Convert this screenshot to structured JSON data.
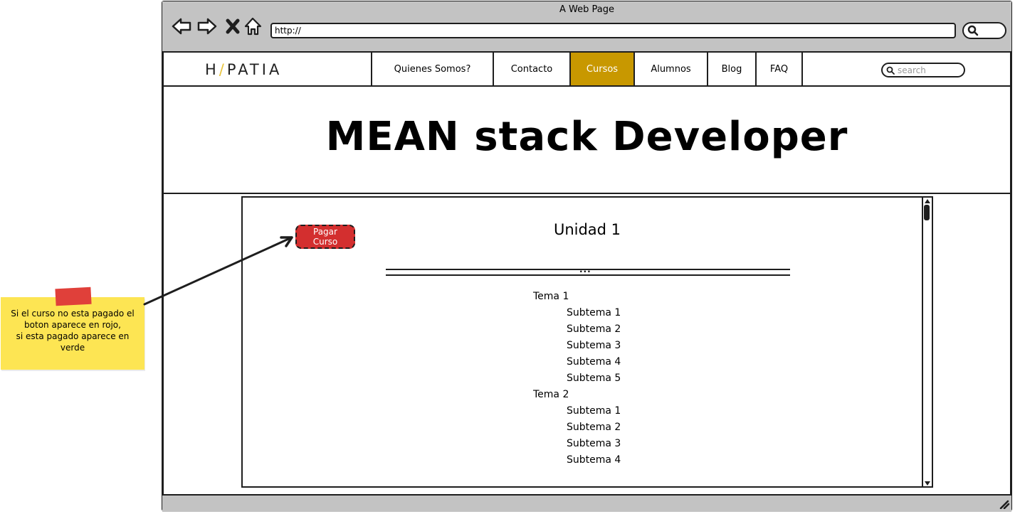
{
  "browser": {
    "window_title": "A Web Page",
    "url": "http://"
  },
  "site": {
    "logo": {
      "left": "H",
      "slash": "/",
      "right": "PATIA"
    },
    "nav": [
      {
        "label": "Quienes Somos?",
        "active": false
      },
      {
        "label": "Contacto",
        "active": false
      },
      {
        "label": "Cursos",
        "active": true
      },
      {
        "label": "Alumnos",
        "active": false
      },
      {
        "label": "Blog",
        "active": false
      },
      {
        "label": "FAQ",
        "active": false
      }
    ],
    "search_placeholder": "search",
    "accent_color": "#c89800"
  },
  "hero": {
    "title": "MEAN stack Developer"
  },
  "course": {
    "pay_button_label": "Pagar\nCurso",
    "pay_button_color": "#d32f2f",
    "unit_title": "Unidad 1",
    "divider_text": "...",
    "outline": [
      {
        "label": "Tema 1",
        "subtemas": [
          "Subtema 1",
          "Subtema 2",
          "Subtema 3",
          "Subtema 4",
          "Subtema 5"
        ]
      },
      {
        "label": "Tema 2",
        "subtemas": [
          "Subtema 1",
          "Subtema 2",
          "Subtema 3",
          "Subtema 4"
        ]
      }
    ]
  },
  "annotation": {
    "note_text": "Si el curso no esta pagado el\nboton aparece en rojo,\nsi esta pagado aparece en\nverde",
    "note_color": "#fde553"
  }
}
